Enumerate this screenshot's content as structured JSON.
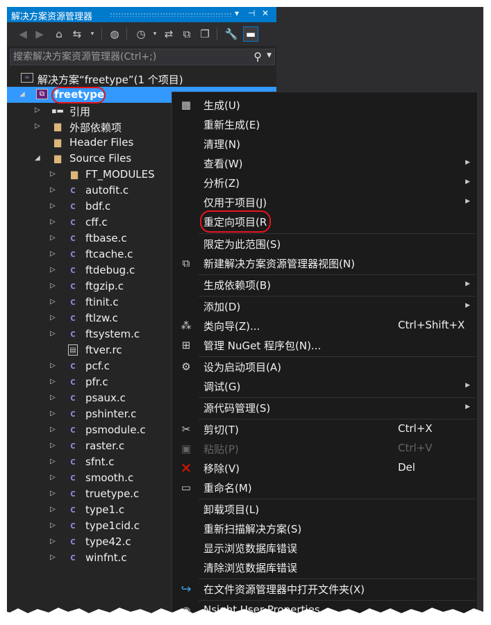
{
  "panel": {
    "title": "解决方案资源管理器",
    "controls": [
      "▾",
      "⊣",
      "✕"
    ]
  },
  "search": {
    "placeholder": "搜索解决方案资源管理器(Ctrl+;)"
  },
  "tree": {
    "solution": "解决方案“freetype”(1 个项目)",
    "project": "freetype",
    "references": "引用",
    "external_deps": "外部依赖项",
    "header_files": "Header Files",
    "source_files": "Source Files",
    "ft_modules": "FT_MODULES",
    "files": [
      "autofit.c",
      "bdf.c",
      "cff.c",
      "ftbase.c",
      "ftcache.c",
      "ftdebug.c",
      "ftgzip.c",
      "ftinit.c",
      "ftlzw.c",
      "ftsystem.c",
      "ftver.rc",
      "pcf.c",
      "pfr.c",
      "psaux.c",
      "pshinter.c",
      "psmodule.c",
      "raster.c",
      "sfnt.c",
      "smooth.c",
      "truetype.c",
      "type1.c",
      "type1cid.c",
      "type42.c",
      "winfnt.c"
    ]
  },
  "menu": {
    "build": "生成(U)",
    "rebuild": "重新生成(E)",
    "clean": "清理(N)",
    "view": "查看(W)",
    "analyze": "分析(Z)",
    "project_only": "仅用于项目(J)",
    "retarget": "重定向项目(R",
    "scope": "限定为此范围(S)",
    "new_view": "新建解决方案资源管理器视图(N)",
    "build_deps": "生成依赖项(B)",
    "add": "添加(D)",
    "class_wizard": "类向导(Z)...",
    "class_wizard_shortcut": "Ctrl+Shift+X",
    "nuget": "管理 NuGet 程序包(N)...",
    "set_startup": "设为启动项目(A)",
    "debug": "调试(G)",
    "source_control": "源代码管理(S)",
    "cut": "剪切(T)",
    "cut_shortcut": "Ctrl+X",
    "paste": "粘贴(P)",
    "paste_shortcut": "Ctrl+V",
    "remove": "移除(V)",
    "remove_shortcut": "Del",
    "rename": "重命名(M)",
    "unload": "卸载项目(L)",
    "rescan": "重新扫描解决方案(S)",
    "show_browse_errors": "显示浏览数据库错误",
    "clear_browse_errors": "清除浏览数据库错误",
    "open_in_explorer": "在文件资源管理器中打开文件夹(X)",
    "nsight": "Nsight User Properties"
  },
  "colors": {
    "accent": "#007acc",
    "selection": "#3399ff",
    "highlight_ring": "#e8141c"
  }
}
